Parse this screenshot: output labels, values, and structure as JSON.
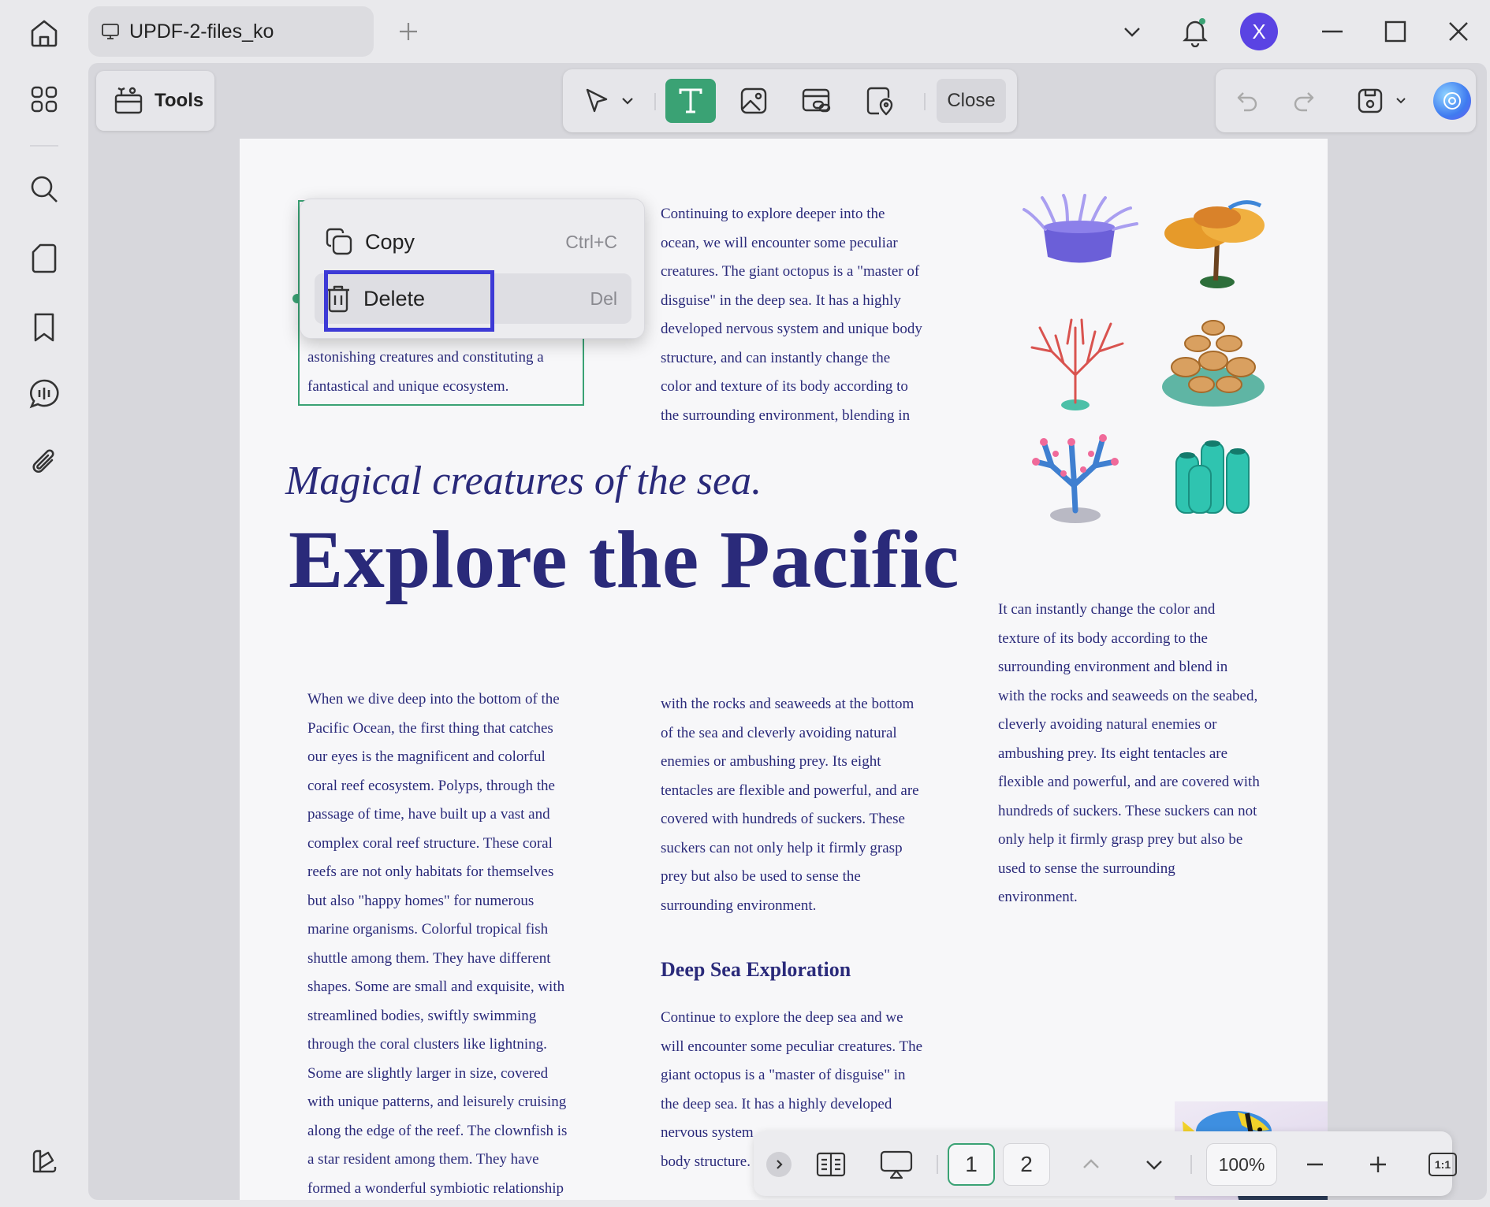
{
  "tab": {
    "title": "UPDF-2-files_ko"
  },
  "avatar": {
    "initial": "X"
  },
  "toolbar": {
    "tools_label": "Tools",
    "close_label": "Close"
  },
  "context_menu": {
    "items": [
      {
        "label": "Copy",
        "shortcut": "Ctrl+C"
      },
      {
        "label": "Delete",
        "shortcut": "Del"
      }
    ]
  },
  "page": {
    "selected_text": [
      "astonishing creatures and constituting a",
      "fantastical and unique ecosystem."
    ],
    "col2_top": [
      "Continuing to explore deeper into the",
      "ocean, we will encounter some peculiar",
      "creatures. The giant octopus is a \"master of",
      "disguise\" in the deep sea. It has a highly",
      "developed nervous system and unique body",
      "structure, and can instantly change the",
      "color and texture of its body according to",
      "the surrounding environment, blending in"
    ],
    "heading_sub": "Magical creatures of the sea.",
    "heading_main": "Explore the Pacific",
    "col3": [
      "It can instantly change the color and",
      "texture of its body according to the",
      "surrounding environment and blend in",
      "with the rocks and seaweeds on the seabed,",
      "cleverly avoiding natural enemies or",
      "ambushing prey. Its eight tentacles are",
      "flexible and powerful, and are covered with",
      "hundreds of suckers. These suckers can not",
      "only help it firmly grasp prey but also be",
      "used to sense the surrounding",
      "environment."
    ],
    "col1": [
      "When we dive deep into the bottom of the",
      "Pacific Ocean, the first thing that catches",
      "our eyes is the magnificent and colorful",
      "coral reef ecosystem. Polyps, through the",
      "passage of time, have built up a vast and",
      "complex coral reef structure. These coral",
      "reefs are not only habitats for themselves",
      "but also \"happy homes\" for numerous",
      "marine organisms. Colorful tropical fish",
      "shuttle among them. They have different",
      "shapes. Some are small and exquisite, with",
      "streamlined bodies, swiftly swimming",
      "through the coral clusters like lightning.",
      "Some are slightly larger in size, covered",
      "with unique patterns, and leisurely cruising",
      "along the edge of the reef. The clownfish is",
      "a star resident among them. They have",
      "formed a wonderful symbiotic relationship"
    ],
    "col2_mid": [
      "with the rocks and seaweeds at the bottom",
      "of the sea and cleverly avoiding natural",
      "enemies or ambushing prey. Its eight",
      "tentacles are flexible and powerful, and are",
      "covered with hundreds of suckers. These",
      "suckers can not only help it firmly grasp",
      "prey but also be used to sense the",
      "surrounding environment."
    ],
    "heading_deep": "Deep Sea Exploration",
    "col2_bottom": [
      "Continue to explore the deep sea and we",
      "will encounter some peculiar creatures. The",
      "giant octopus is a \"master of disguise\" in",
      "the deep sea. It has a highly developed",
      "nervous system",
      "body structure."
    ]
  },
  "bottom_bar": {
    "pages": [
      "1",
      "2"
    ],
    "current_page": "1",
    "zoom": "100%",
    "fit_label": "1:1"
  },
  "colors": {
    "accent": "#3aa274",
    "highlight": "#3d3ad6",
    "text": "#2a2a7a",
    "avatar": "#5a43e3"
  }
}
